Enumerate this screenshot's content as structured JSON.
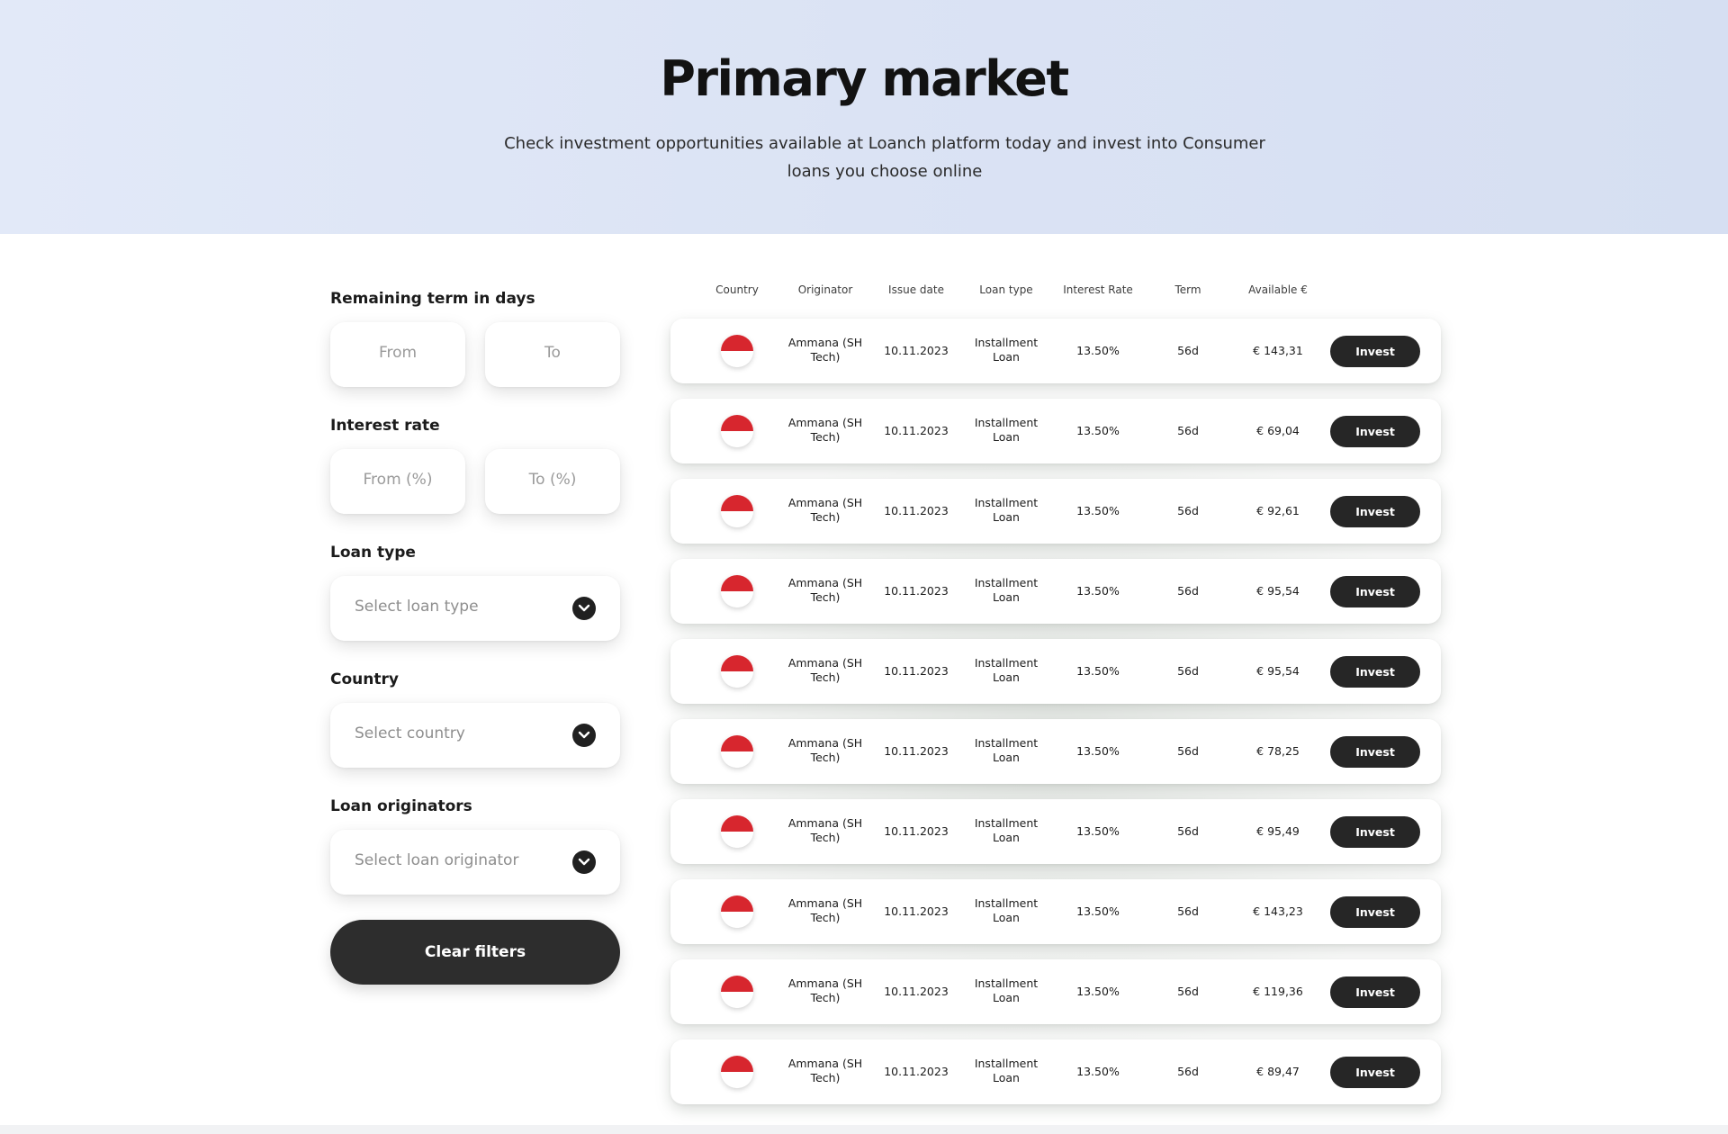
{
  "hero": {
    "title": "Primary market",
    "subtitle": "Check investment opportunities available at Loanch platform today and invest into Consumer loans you choose online"
  },
  "filters": {
    "remaining_term": {
      "label": "Remaining term in days",
      "from_placeholder": "From",
      "to_placeholder": "To"
    },
    "interest_rate": {
      "label": "Interest rate",
      "from_placeholder": "From (%)",
      "to_placeholder": "To (%)"
    },
    "loan_type": {
      "label": "Loan type",
      "placeholder": "Select loan type"
    },
    "country": {
      "label": "Country",
      "placeholder": "Select country"
    },
    "loan_originators": {
      "label": "Loan originators",
      "placeholder": "Select loan originator"
    },
    "clear_label": "Clear filters"
  },
  "table": {
    "headers": [
      "Country",
      "Originator",
      "Issue date",
      "Loan type",
      "Interest Rate",
      "Term",
      "Available €"
    ],
    "invest_label": "Invest",
    "flag_colors": {
      "top": "#d7262e",
      "bottom": "#ffffff"
    },
    "rows": [
      {
        "originator": "Ammana (SH Tech)",
        "issue_date": "10.11.2023",
        "loan_type": "Installment Loan",
        "interest_rate": "13.50%",
        "term": "56d",
        "available": "€ 143,31"
      },
      {
        "originator": "Ammana (SH Tech)",
        "issue_date": "10.11.2023",
        "loan_type": "Installment Loan",
        "interest_rate": "13.50%",
        "term": "56d",
        "available": "€ 69,04"
      },
      {
        "originator": "Ammana (SH Tech)",
        "issue_date": "10.11.2023",
        "loan_type": "Installment Loan",
        "interest_rate": "13.50%",
        "term": "56d",
        "available": "€ 92,61"
      },
      {
        "originator": "Ammana (SH Tech)",
        "issue_date": "10.11.2023",
        "loan_type": "Installment Loan",
        "interest_rate": "13.50%",
        "term": "56d",
        "available": "€ 95,54"
      },
      {
        "originator": "Ammana (SH Tech)",
        "issue_date": "10.11.2023",
        "loan_type": "Installment Loan",
        "interest_rate": "13.50%",
        "term": "56d",
        "available": "€ 95,54"
      },
      {
        "originator": "Ammana (SH Tech)",
        "issue_date": "10.11.2023",
        "loan_type": "Installment Loan",
        "interest_rate": "13.50%",
        "term": "56d",
        "available": "€ 78,25"
      },
      {
        "originator": "Ammana (SH Tech)",
        "issue_date": "10.11.2023",
        "loan_type": "Installment Loan",
        "interest_rate": "13.50%",
        "term": "56d",
        "available": "€ 95,49"
      },
      {
        "originator": "Ammana (SH Tech)",
        "issue_date": "10.11.2023",
        "loan_type": "Installment Loan",
        "interest_rate": "13.50%",
        "term": "56d",
        "available": "€ 143,23"
      },
      {
        "originator": "Ammana (SH Tech)",
        "issue_date": "10.11.2023",
        "loan_type": "Installment Loan",
        "interest_rate": "13.50%",
        "term": "56d",
        "available": "€ 119,36"
      },
      {
        "originator": "Ammana (SH Tech)",
        "issue_date": "10.11.2023",
        "loan_type": "Installment Loan",
        "interest_rate": "13.50%",
        "term": "56d",
        "available": "€ 89,47"
      }
    ]
  }
}
